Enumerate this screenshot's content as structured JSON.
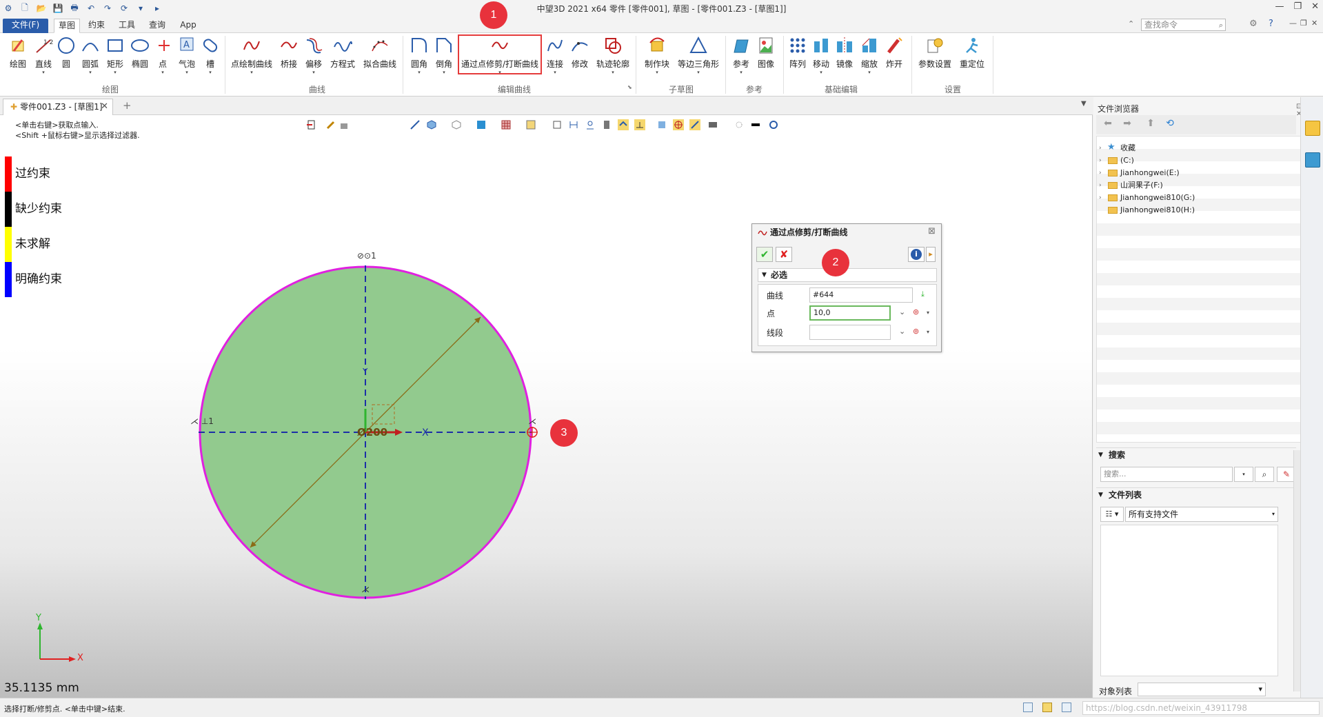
{
  "window": {
    "title": "中望3D 2021 x64     零件 [零件001], 草图 - [零件001.Z3 - [草图1]]",
    "controls": [
      "—",
      "❐",
      "✕"
    ]
  },
  "tabs": [
    "文件(F)",
    "草图",
    "约束",
    "工具",
    "查询",
    "App"
  ],
  "search_command": {
    "placeholder": "查找命令"
  },
  "ribbon": {
    "groups": [
      {
        "label": "绘图",
        "buttons": [
          "绘图",
          "直线",
          "圆",
          "圆弧",
          "矩形",
          "椭圆",
          "点",
          "气泡",
          "槽"
        ]
      },
      {
        "label": "曲线",
        "buttons": [
          "点绘制曲线",
          "桥接",
          "偏移",
          "方程式",
          "拟合曲线"
        ]
      },
      {
        "label": "编辑曲线",
        "buttons": [
          "圆角",
          "倒角",
          "通过点修剪/打断曲线",
          "连接",
          "修改",
          "轨迹轮廓"
        ]
      },
      {
        "label": "子草图",
        "buttons": [
          "制作块",
          "等边三角形"
        ]
      },
      {
        "label": "参考",
        "buttons": [
          "参考",
          "图像"
        ]
      },
      {
        "label": "基础编辑",
        "buttons": [
          "阵列",
          "移动",
          "镜像",
          "缩放",
          "炸开"
        ]
      },
      {
        "label": "设置",
        "buttons": [
          "参数设置",
          "重定位"
        ]
      }
    ]
  },
  "callouts": [
    "1",
    "2",
    "3"
  ],
  "document_tab": {
    "label": "零件001.Z3 - [草图1]",
    "close": "✕",
    "add": "+"
  },
  "canvas": {
    "hints": [
      "<单击右键>获取点输入.",
      "<Shift +鼠标右键>显示选择过滤器."
    ],
    "legend": [
      {
        "label": "过约束",
        "color": "#ff0000"
      },
      {
        "label": "缺少约束",
        "color": "#000000"
      },
      {
        "label": "未求解",
        "color": "#ffff00"
      },
      {
        "label": "明确约束",
        "color": "#0000ff"
      }
    ],
    "readout": "35.1135 mm",
    "triad": {
      "x": "X",
      "y": "Y"
    }
  },
  "dialog": {
    "title": "通过点修剪/打断曲线",
    "section": "必选",
    "fields": [
      {
        "label": "曲线",
        "value": "#644"
      },
      {
        "label": "点",
        "value": "10,0"
      },
      {
        "label": "线段",
        "value": ""
      }
    ]
  },
  "file_browser": {
    "title": "文件浏览器",
    "tree": [
      {
        "label": "收藏",
        "type": "star"
      },
      {
        "label": "(C:)",
        "type": "folder"
      },
      {
        "label": "Jianhongwei(E:)",
        "type": "folder"
      },
      {
        "label": "山涧果子(F:)",
        "type": "folder"
      },
      {
        "label": "Jianhongwei810(G:)",
        "type": "folder"
      },
      {
        "label": "Jianhongwei810(H:)",
        "type": "folder"
      }
    ],
    "search_section": "搜索",
    "search_placeholder": "搜索...",
    "file_list_section": "文件列表",
    "filter_value": "所有支持文件",
    "object_list_label": "对象列表"
  },
  "statusbar": {
    "message": "选择打断/修剪点. <单击中键>结束.",
    "watermark": "https://blog.csdn.net/weixin_43911798"
  }
}
